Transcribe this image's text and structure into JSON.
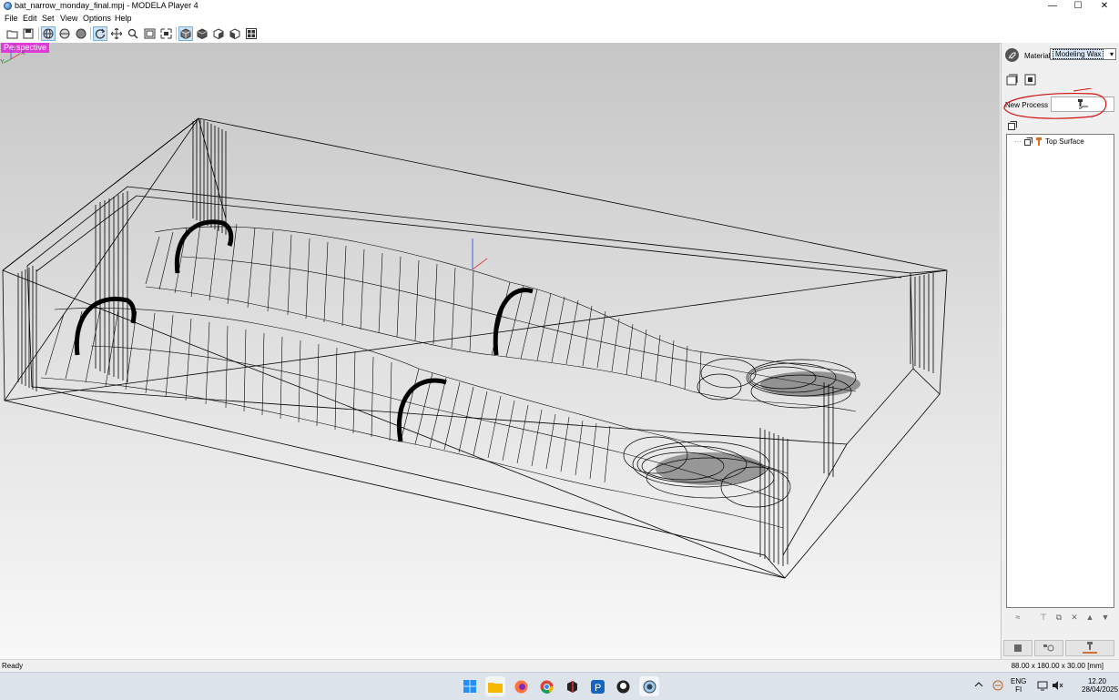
{
  "window": {
    "title": "bat_narrow_monday_final.mpj - MODELA Player 4",
    "controls": {
      "minimize": "—",
      "maximize": "☐",
      "close": "✕"
    }
  },
  "menu": [
    "File",
    "Edit",
    "Set",
    "View",
    "Options",
    "Help"
  ],
  "toolbar": {
    "icons": [
      "open-file",
      "save",
      "globe-view",
      "sphere-view",
      "shaded-sphere",
      "rotate",
      "pan",
      "zoom",
      "fit-window",
      "zoom-window",
      "iso-view",
      "front-view",
      "side-view",
      "back-view",
      "multi-view"
    ]
  },
  "viewport": {
    "view_label": "Perspective",
    "axis_labels": {
      "z": "Z",
      "x": "X",
      "y": "Y"
    }
  },
  "panel": {
    "material_label": "Material",
    "material_value": "Modeling Wax",
    "new_process_label": "New Process",
    "tree_items": [
      {
        "label": "Top Surface"
      }
    ]
  },
  "status": {
    "left": "Ready",
    "dimensions": "88.00 x 180.00 x 30.00 [mm]"
  },
  "tray": {
    "lang_line1": "ENG",
    "lang_line2": "FI",
    "time": "12.20",
    "date": "28/04/2025"
  }
}
